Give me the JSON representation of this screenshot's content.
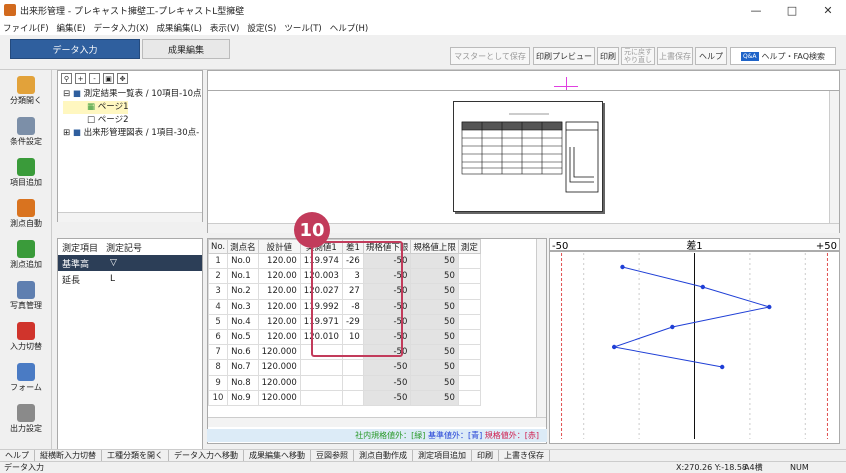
{
  "window": {
    "title": "出来形管理 - プレキャスト擁壁工-プレキャストL型擁壁"
  },
  "menu": [
    "ファイル(F)",
    "編集(E)",
    "データ入力(X)",
    "成果編集(L)",
    "表示(V)",
    "設定(S)",
    "ツール(T)",
    "ヘルプ(H)"
  ],
  "toolbar": {
    "tab_data_input": "データ入力",
    "tab_result_edit": "成果編集",
    "save_as_master": "マスターとして保存",
    "print_preview": "印刷プレビュー",
    "print": "印刷",
    "undo_line1": "元に戻す",
    "undo_line2": "やり直し",
    "overwrite_save": "上書保存",
    "help": "ヘルプ",
    "help_faq": "ヘルプ・FAQ検索",
    "qa_badge": "Q&A"
  },
  "sidebar": [
    {
      "label": "分類開く",
      "icon": "folder-open-icon",
      "color": "#e2a23a"
    },
    {
      "label": "条件設定",
      "icon": "wrench-icon",
      "color": "#7c8fa8"
    },
    {
      "label": "項目追加",
      "icon": "add-item-icon",
      "color": "#3a9b3a"
    },
    {
      "label": "測点自動",
      "icon": "auto-point-icon",
      "color": "#d9731f"
    },
    {
      "label": "測点追加",
      "icon": "add-point-icon",
      "color": "#3a9b3a"
    },
    {
      "label": "写真管理",
      "icon": "camera-icon",
      "color": "#5f7fb0"
    },
    {
      "label": "入力切替",
      "icon": "switch-icon",
      "color": "#d0342c"
    },
    {
      "label": "フォーム",
      "icon": "form-icon",
      "color": "#4a7bc4"
    },
    {
      "label": "出力設定",
      "icon": "output-icon",
      "color": "#8a8a8a"
    }
  ],
  "tree": {
    "node1": "測定結果一覧表 / 10項目-10点",
    "page1": "ページ1",
    "page2": "ページ2",
    "node2": "出来形管理図表 / 1項目-30点-"
  },
  "measurement_list": {
    "header_item": "測定項目",
    "header_code": "測定記号",
    "rows": [
      {
        "item": "基準高",
        "code": "▽"
      },
      {
        "item": "延長",
        "code": "L"
      }
    ]
  },
  "grid": {
    "headers": [
      "No.",
      "測点名",
      "設計値",
      "実測値1",
      "差1",
      "規格値下限",
      "規格値上限",
      "測定"
    ],
    "rows": [
      [
        "1",
        "No.0",
        "120.00",
        "119.974",
        "-26",
        "-50",
        "50"
      ],
      [
        "2",
        "No.1",
        "120.00",
        "120.003",
        "3",
        "-50",
        "50"
      ],
      [
        "3",
        "No.2",
        "120.00",
        "120.027",
        "27",
        "-50",
        "50"
      ],
      [
        "4",
        "No.3",
        "120.00",
        "119.992",
        "-8",
        "-50",
        "50"
      ],
      [
        "5",
        "No.4",
        "120.00",
        "119.971",
        "-29",
        "-50",
        "50"
      ],
      [
        "6",
        "No.5",
        "120.00",
        "120.010",
        "10",
        "-50",
        "50"
      ],
      [
        "7",
        "No.6",
        "120.000",
        "",
        "",
        "-50",
        "50"
      ],
      [
        "8",
        "No.7",
        "120.000",
        "",
        "",
        "-50",
        "50"
      ],
      [
        "9",
        "No.8",
        "120.000",
        "",
        "",
        "-50",
        "50"
      ],
      [
        "10",
        "No.9",
        "120.000",
        "",
        "",
        "-50",
        "50"
      ]
    ],
    "legend_internal": "社内規格値外：[緑]",
    "legend_base": "基準値外：[青]",
    "legend_spec": "規格値外：[赤]"
  },
  "callout": {
    "number": "10",
    "color": "#c23b5b"
  },
  "chart_data": {
    "type": "line",
    "title": "差1",
    "xlim": [
      -50,
      50
    ],
    "xlabel_left": "-50",
    "xlabel_right": "+50",
    "series": [
      {
        "values": [
          -26,
          3,
          27,
          -8,
          -29,
          10
        ]
      }
    ],
    "line_color": "#1f3fd6",
    "limit_color": "#e05050"
  },
  "bottom_buttons": [
    "ヘルプ",
    "縦横断入力切替",
    "工種分類を開く",
    "データ入力へ移動",
    "成果編集へ移動",
    "豆図参照",
    "測点自動作成",
    "測定項目追加",
    "印刷",
    "上書き保存"
  ],
  "status": {
    "mode": "データ入力",
    "coords": "X:270.26  Y:-18.58",
    "paper": "A4横",
    "num": "NUM"
  }
}
